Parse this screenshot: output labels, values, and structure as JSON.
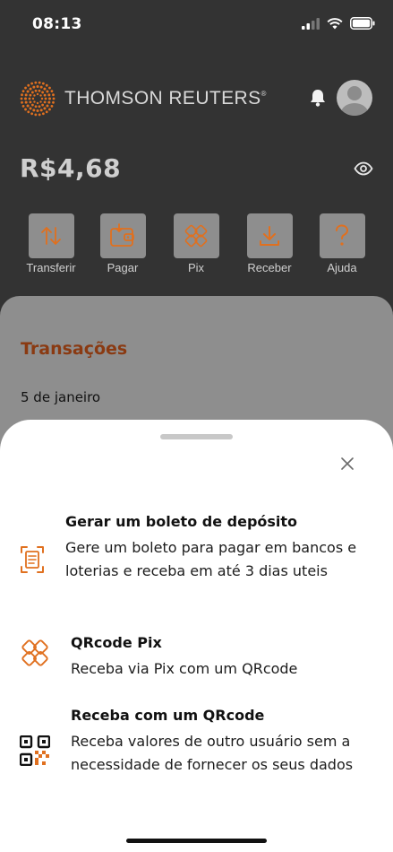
{
  "status": {
    "time": "08:13"
  },
  "header": {
    "brand": "THOMSON REUTERS",
    "brand_mark": "®"
  },
  "account": {
    "balance": "R$4,68"
  },
  "actions": [
    {
      "label": "Transferir",
      "icon": "transfer-arrows-icon"
    },
    {
      "label": "Pagar",
      "icon": "wallet-pay-icon"
    },
    {
      "label": "Pix",
      "icon": "pix-icon"
    },
    {
      "label": "Receber",
      "icon": "download-receive-icon"
    },
    {
      "label": "Ajuda",
      "icon": "help-question-icon"
    }
  ],
  "transactions": {
    "title": "Transações",
    "date": "5 de janeiro"
  },
  "sheet": {
    "options": [
      {
        "title": "Gerar um boleto de depósito",
        "description": "Gere um boleto para pagar em bancos e loterias e receba em até 3 dias uteis",
        "icon": "boleto-scan-icon"
      },
      {
        "title": "QRcode Pix",
        "description": "Receba via Pix com um QRcode",
        "icon": "pix-icon"
      },
      {
        "title": "Receba com um QRcode",
        "description": "Receba valores de outro usuário sem a necessidade de fornecer os seus dados",
        "icon": "qrcode-icon"
      }
    ]
  },
  "colors": {
    "accent": "#e0701f",
    "header_bg": "#333333",
    "panel_bg": "#8e8e8e",
    "title_brown": "#8a3a12"
  }
}
